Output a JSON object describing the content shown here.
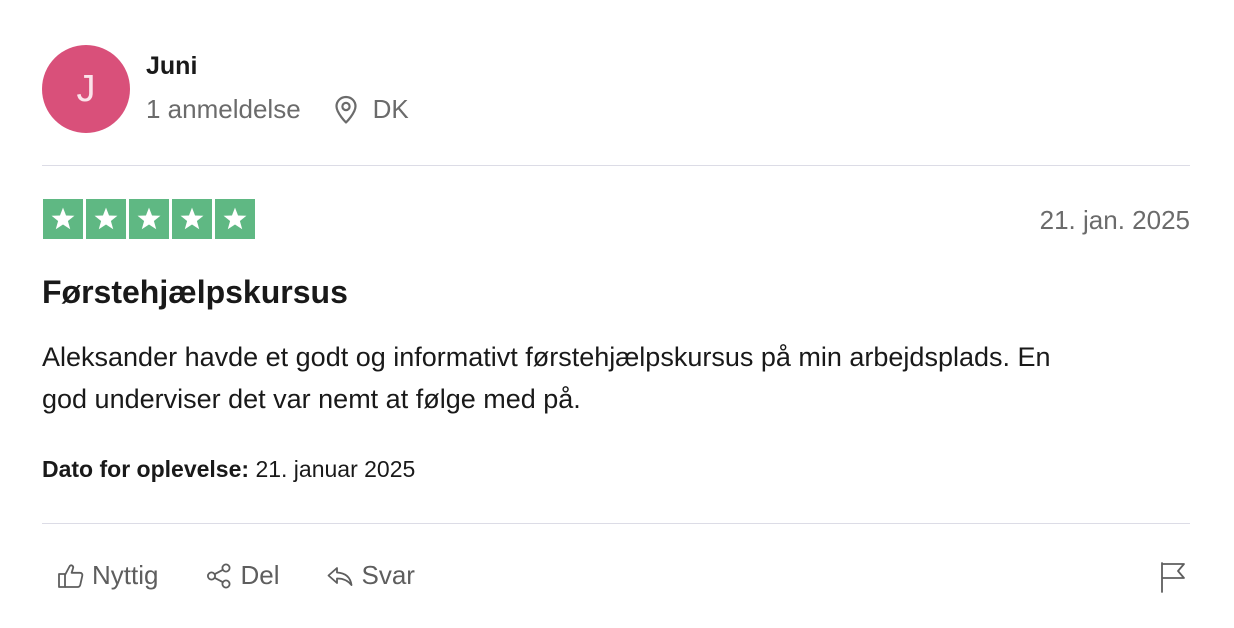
{
  "reviewer": {
    "initial": "J",
    "name": "Juni",
    "review_count": "1 anmeldelse",
    "country": "DK",
    "avatar_color": "#d9507a"
  },
  "rating": {
    "stars": 5,
    "max_stars": 5,
    "star_color": "#5fb883",
    "date": "21. jan. 2025"
  },
  "review": {
    "title": "Førstehjælpskursus",
    "body": "Aleksander havde et godt og informativt førstehjælpskursus på min arbejdsplads. En god underviser det var nemt at følge med på.",
    "experience_label": "Dato for oplevelse:",
    "experience_date": "21. januar 2025"
  },
  "actions": {
    "helpful_label": "Nyttig",
    "helpful_icon": "thumbs-up-icon",
    "share_label": "Del",
    "share_icon": "share-icon",
    "reply_label": "Svar",
    "reply_icon": "reply-icon",
    "report_icon": "flag-icon"
  }
}
